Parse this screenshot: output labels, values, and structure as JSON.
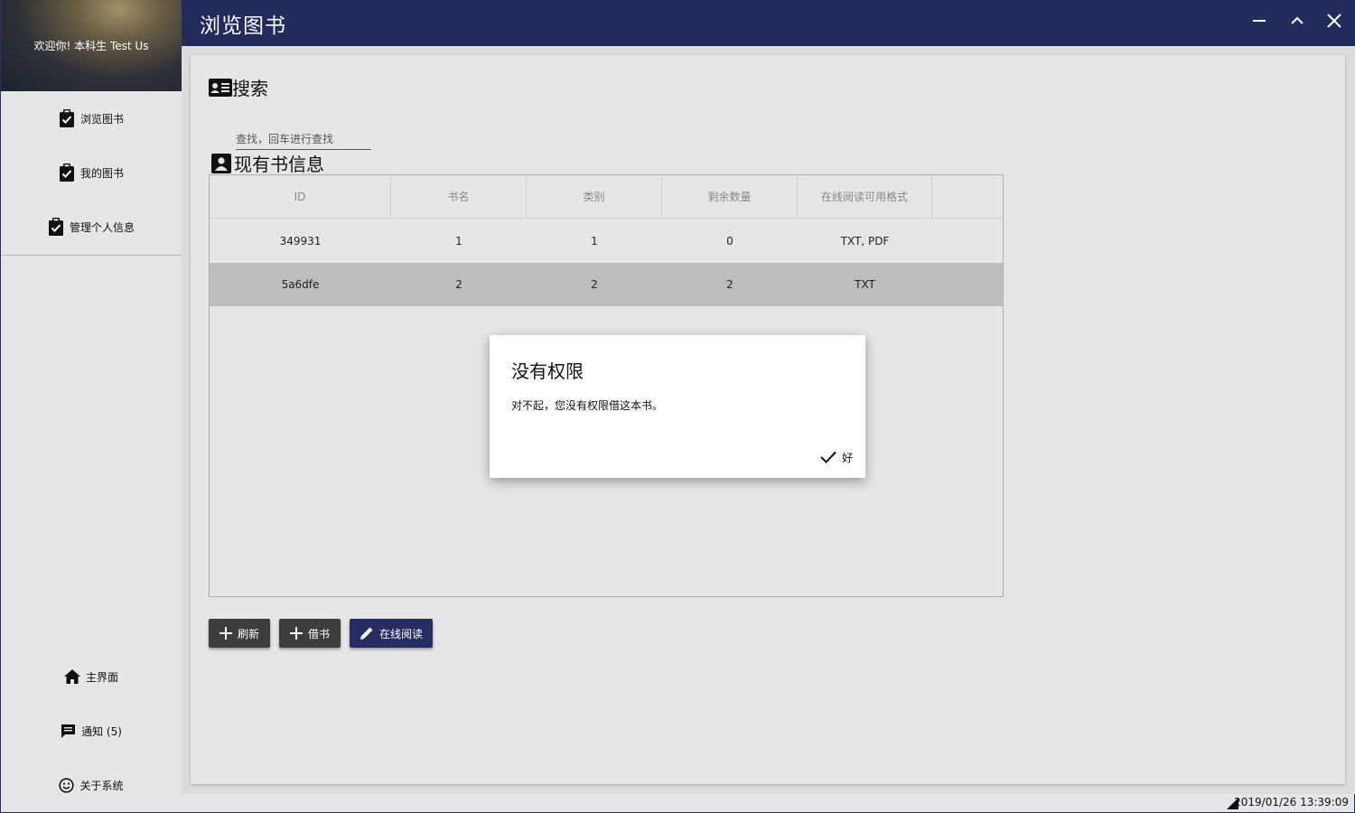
{
  "window": {
    "title": "浏览图书",
    "controls": [
      "minimize-icon",
      "maximize-icon",
      "close-icon"
    ]
  },
  "sidebar": {
    "welcome": "欢迎你! 本科生 Test Us",
    "top_items": [
      {
        "label": "浏览图书",
        "icon": "clipboard-check-icon"
      },
      {
        "label": "我的图书",
        "icon": "clipboard-check-icon"
      },
      {
        "label": "管理个人信息",
        "icon": "clipboard-check-icon"
      }
    ],
    "bottom_items": [
      {
        "label": "主界面",
        "icon": "home-icon"
      },
      {
        "label": "通知 (5)",
        "icon": "message-icon"
      },
      {
        "label": "关于系统",
        "icon": "smiley-icon"
      }
    ]
  },
  "search": {
    "heading": "搜索",
    "placeholder": "查找，回车进行查找"
  },
  "books": {
    "heading": "现有书信息",
    "columns": [
      "ID",
      "书名",
      "类别",
      "剩余数量",
      "在线阅读可用格式"
    ],
    "rows": [
      [
        "349931",
        "1",
        "1",
        "0",
        "TXT, PDF"
      ],
      [
        "5a6dfe",
        "2",
        "2",
        "2",
        "TXT"
      ]
    ],
    "selected_row": 1
  },
  "actions": {
    "refresh": "刷新",
    "borrow": "借书",
    "read_online": "在线阅读"
  },
  "dialog": {
    "title": "没有权限",
    "message": "对不起，您没有权限借这本书。",
    "ok": "好"
  },
  "status": {
    "datetime": "2019/01/26 13:39:09"
  },
  "colors": {
    "titlebar": "#232a5c",
    "primary_button": "#262d63",
    "dark_button": "#3d3d3d",
    "selected_row": "#bdbdbd"
  }
}
